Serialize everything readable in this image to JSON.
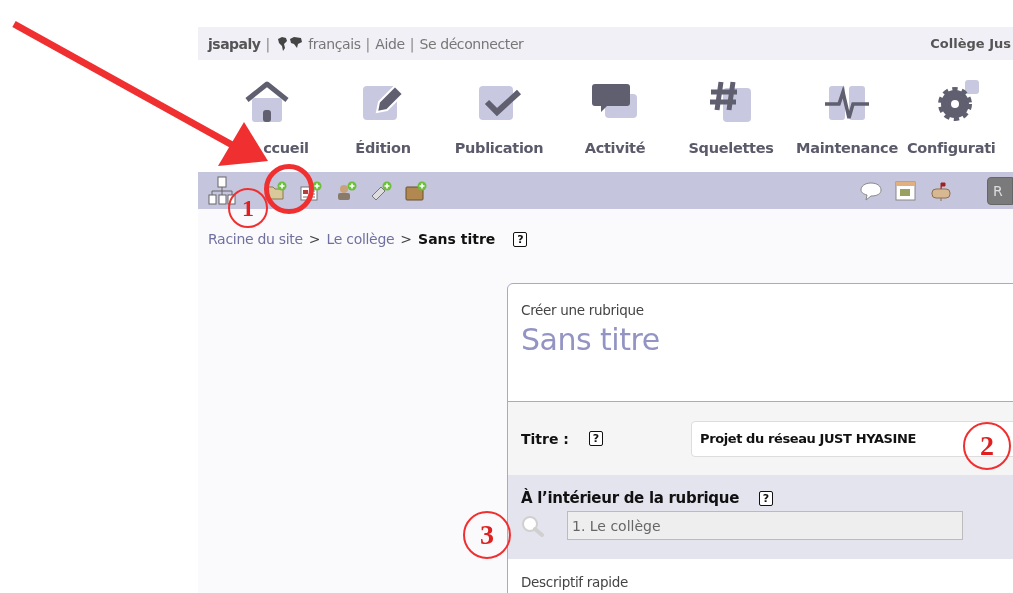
{
  "user_bar": {
    "items": [
      {
        "kind": "user",
        "text": "jsapaly"
      },
      {
        "kind": "separator",
        "text": "|"
      },
      {
        "kind": "language",
        "text": "français"
      },
      {
        "kind": "separator",
        "text": "|"
      },
      {
        "kind": "link",
        "text": "Aide"
      },
      {
        "kind": "separator",
        "text": "|"
      },
      {
        "kind": "link",
        "text": "Se déconnecter"
      }
    ],
    "site_name": "Collège Jus"
  },
  "nav": [
    {
      "label": "ccueil"
    },
    {
      "label": "Édition"
    },
    {
      "label": "Publication"
    },
    {
      "label": "Activité"
    },
    {
      "label": "Squelettes"
    },
    {
      "label": "Maintenance"
    },
    {
      "label": "Configurati"
    }
  ],
  "toolbar": {
    "right_button": "R"
  },
  "breadcrumb": [
    {
      "kind": "link",
      "text": "Racine du site"
    },
    {
      "kind": "separator",
      "text": ">"
    },
    {
      "kind": "link",
      "text": "Le collège"
    },
    {
      "kind": "separator",
      "text": ">"
    },
    {
      "kind": "current",
      "text": "Sans titre"
    },
    {
      "kind": "help",
      "text": "?"
    }
  ],
  "form": {
    "subtitle": "Créer une rubrique",
    "title": "Sans titre",
    "title_field": {
      "label": "Titre :",
      "help": "?",
      "value": "Projet du réseau JUST HYASINE"
    },
    "parent_field": {
      "label": "À l’intérieur de la rubrique",
      "help": "?",
      "value": "1. Le collège"
    },
    "next_label": "Descriptif rapide"
  },
  "annotations": [
    {
      "label": "1"
    },
    {
      "label": "2"
    },
    {
      "label": "3"
    }
  ]
}
